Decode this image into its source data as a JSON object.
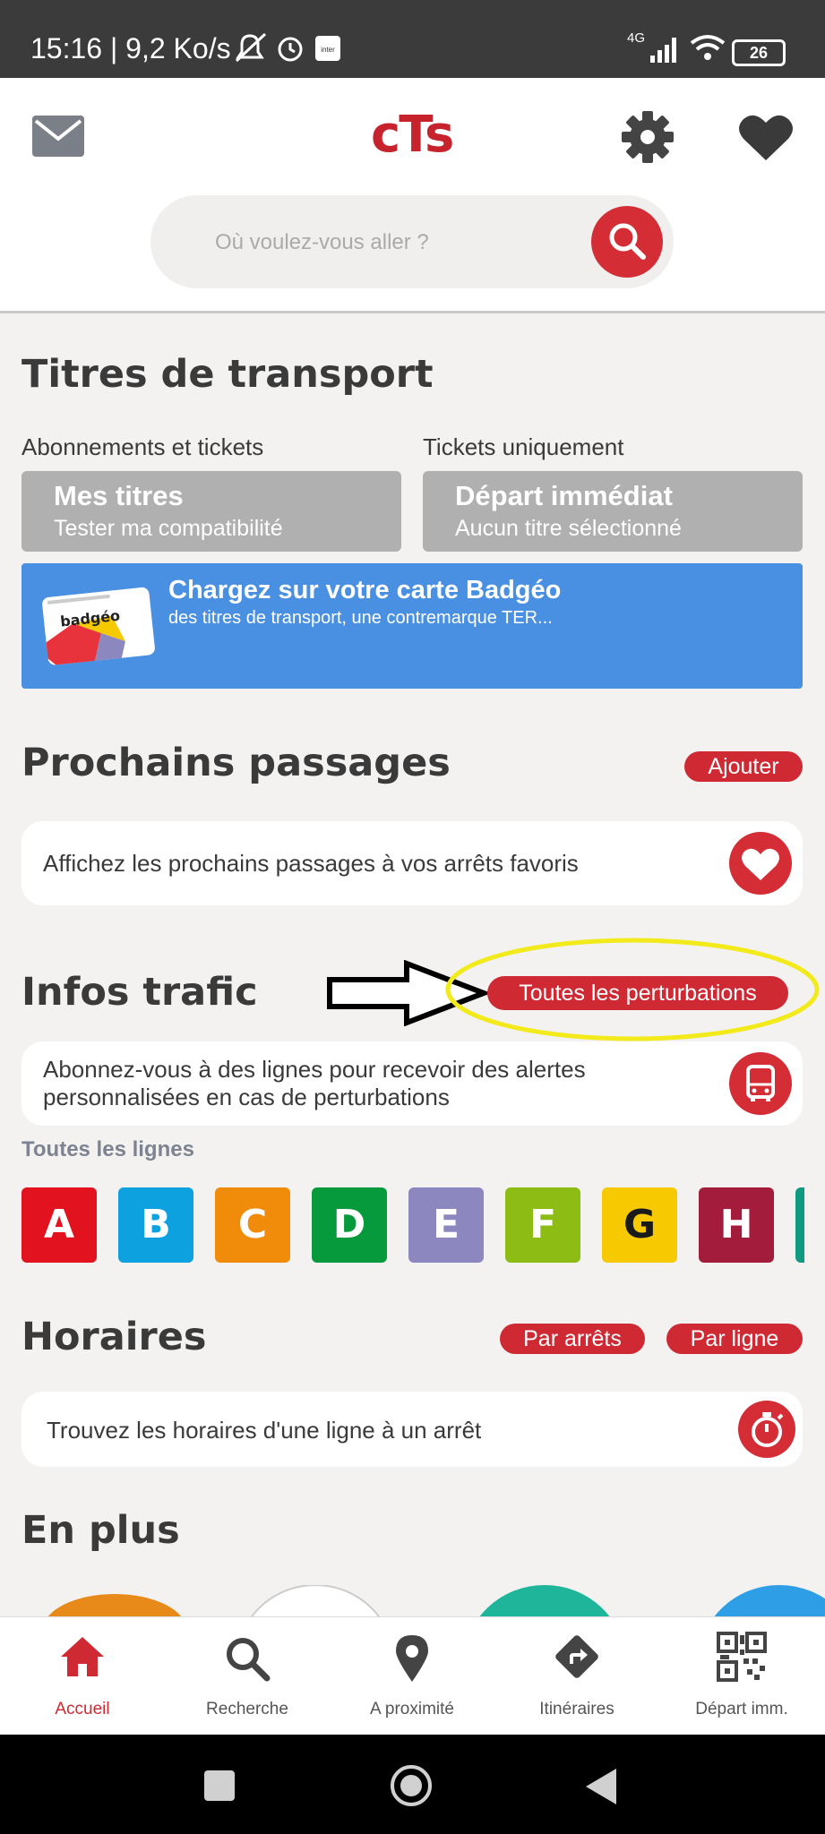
{
  "status_bar": {
    "time": "15:16 | 9,2 Ko/s",
    "network": "4G",
    "battery": "26"
  },
  "header": {
    "logo": "cTs",
    "search_placeholder": "Où voulez-vous aller ?"
  },
  "tickets": {
    "title": "Titres de transport",
    "left_caption": "Abonnements et tickets",
    "right_caption": "Tickets uniquement",
    "mes_titres": {
      "title": "Mes titres",
      "subtitle": "Tester ma compatibilité"
    },
    "depart": {
      "title": "Départ immédiat",
      "subtitle": "Aucun titre sélectionné"
    },
    "badgeo": {
      "card_label": "badgéo",
      "title": "Chargez sur votre carte Badgéo",
      "subtitle": "des titres de transport, une contremarque TER..."
    }
  },
  "passages": {
    "title": "Prochains passages",
    "add_button": "Ajouter",
    "card_text": "Affichez les prochains passages à vos arrêts favoris"
  },
  "trafic": {
    "title": "Infos trafic",
    "all_button": "Toutes les perturbations",
    "card_text_1": "Abonnez-vous à des lignes pour recevoir des alertes",
    "card_text_2": "personnalisées en cas de perturbations",
    "lines_caption": "Toutes les lignes",
    "lines": [
      {
        "label": "A",
        "color": "#e2121f",
        "text": "#ffffff"
      },
      {
        "label": "B",
        "color": "#0ea1df",
        "text": "#ffffff"
      },
      {
        "label": "C",
        "color": "#f08c0a",
        "text": "#ffffff"
      },
      {
        "label": "D",
        "color": "#069a3c",
        "text": "#ffffff"
      },
      {
        "label": "E",
        "color": "#8c87be",
        "text": "#ffffff"
      },
      {
        "label": "F",
        "color": "#8dbc15",
        "text": "#ffffff"
      },
      {
        "label": "G",
        "color": "#f6c900",
        "text": "#1a1a1a"
      },
      {
        "label": "H",
        "color": "#a41c3c",
        "text": "#ffffff"
      }
    ]
  },
  "horaires": {
    "title": "Horaires",
    "btn_stops": "Par arrêts",
    "btn_line": "Par ligne",
    "card_text": "Trouvez les horaires d'une ligne à un arrêt"
  },
  "en_plus": {
    "title": "En plus"
  },
  "bottom_nav": {
    "home": "Accueil",
    "search": "Recherche",
    "nearby": "A proximité",
    "routes": "Itinéraires",
    "depart": "Départ imm."
  },
  "colors": {
    "accent": "#cf2a34",
    "badgeo_blue": "#4a90e2",
    "annotation_yellow": "#f2ea1a"
  }
}
